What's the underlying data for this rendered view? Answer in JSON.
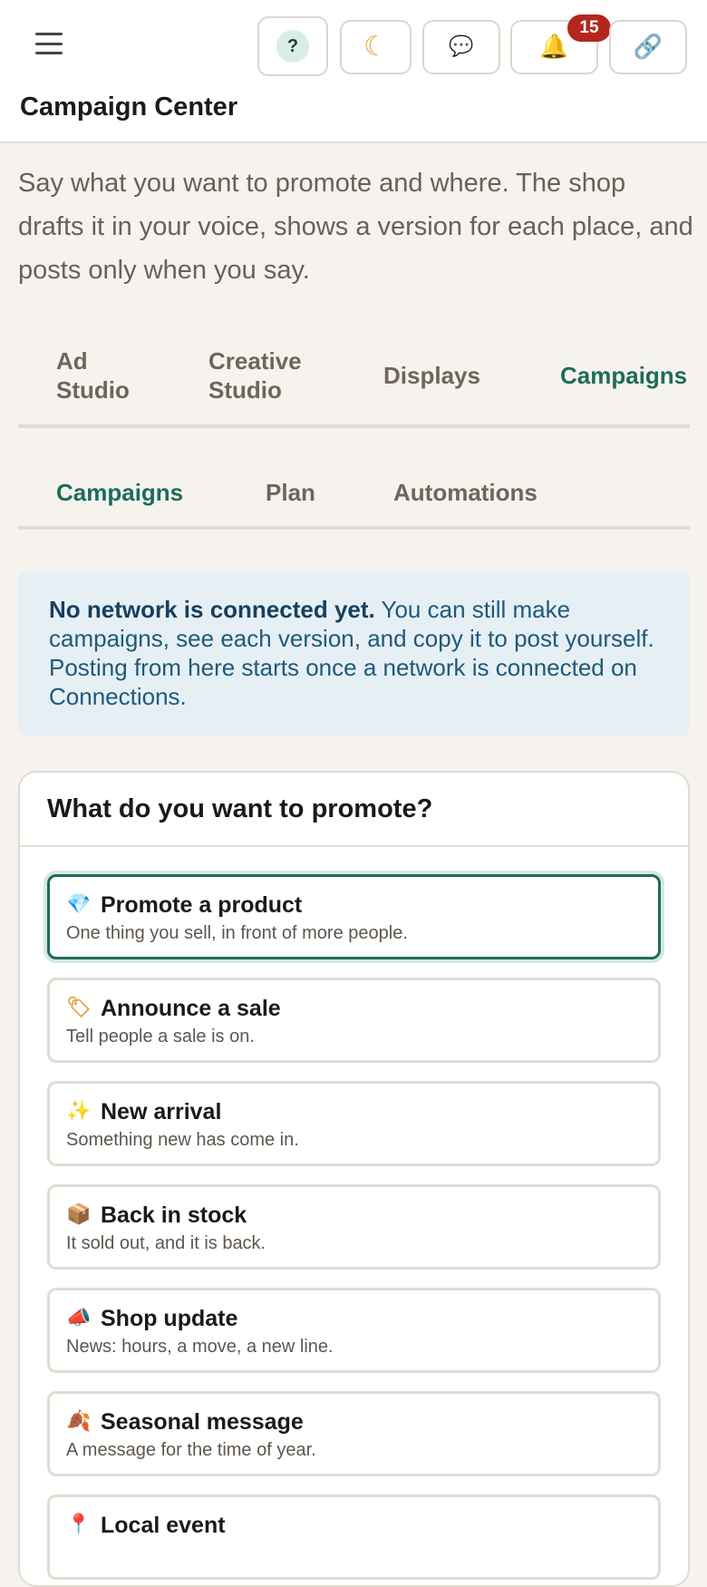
{
  "topbar": {
    "help_label": "?",
    "theme_icon": "☾",
    "chat_icon": "💬",
    "bell_icon": "🔔",
    "link_icon": "🔗",
    "notification_count": "15"
  },
  "page_title": "Campaign Center",
  "intro": "Say what you want to promote and where. The shop drafts it in your voice, shows a version for each place, and posts only when you say.",
  "main_tabs": [
    {
      "label": "Ad Studio"
    },
    {
      "label": "Creative Studio"
    },
    {
      "label": "Displays"
    },
    {
      "label": "Campaigns"
    }
  ],
  "sub_tabs": [
    {
      "label": "Campaigns"
    },
    {
      "label": "Plan"
    },
    {
      "label": "Automations"
    }
  ],
  "notice": {
    "bold": "No network is connected yet.",
    "text": " You can still make campaigns, see each version, and copy it to post yourself. Posting from here starts once a network is connected on Connections."
  },
  "promote": {
    "title": "What do you want to promote?",
    "options": [
      {
        "icon": "💎",
        "title": "Promote a product",
        "desc": "One thing you sell, in front of more people."
      },
      {
        "icon": "🏷",
        "title": "Announce a sale",
        "desc": "Tell people a sale is on."
      },
      {
        "icon": "✨",
        "title": "New arrival",
        "desc": "Something new has come in."
      },
      {
        "icon": "📦",
        "title": "Back in stock",
        "desc": "It sold out, and it is back."
      },
      {
        "icon": "📣",
        "title": "Shop update",
        "desc": "News: hours, a move, a new line."
      },
      {
        "icon": "🍂",
        "title": "Seasonal message",
        "desc": "A message for the time of year."
      },
      {
        "icon": "📍",
        "title": "Local event",
        "desc": ""
      }
    ]
  }
}
